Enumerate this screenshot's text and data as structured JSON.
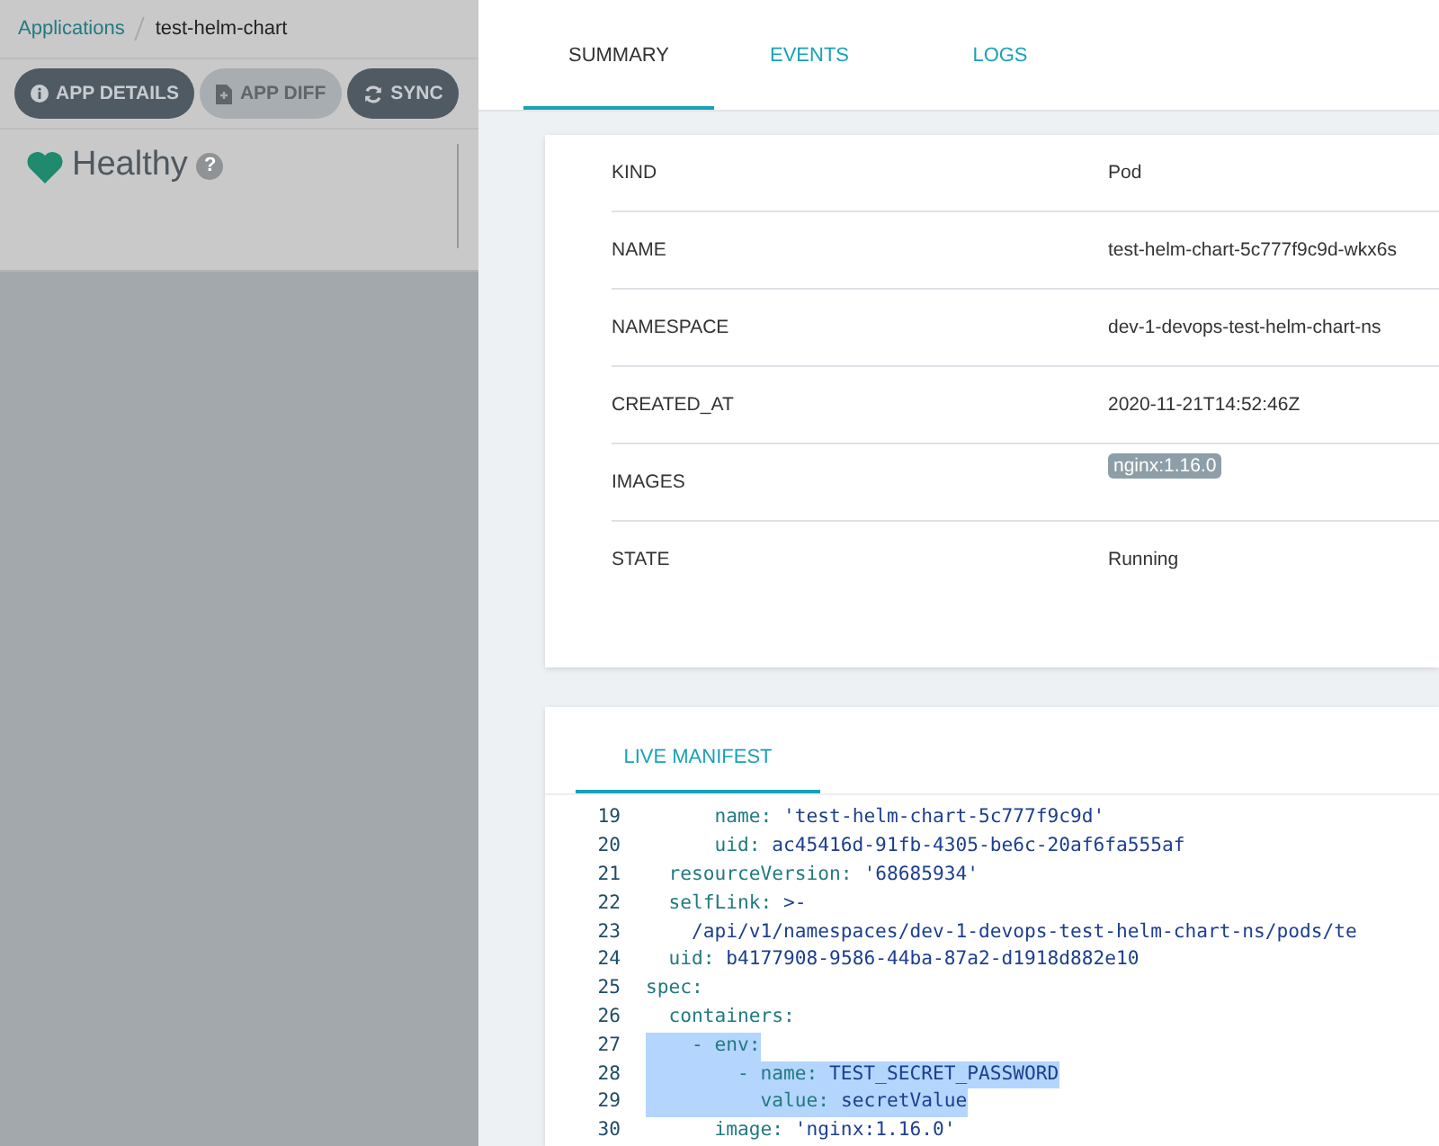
{
  "breadcrumb": {
    "link": "Applications",
    "current": "test-helm-chart"
  },
  "toolbar": [
    {
      "label": "APP DETAILS",
      "kind": "info",
      "disabled": false
    },
    {
      "label": "APP DIFF",
      "kind": "file",
      "disabled": true
    },
    {
      "label": "SYNC",
      "kind": "sync",
      "disabled": false
    }
  ],
  "health": {
    "status": "Healthy",
    "help": "?"
  },
  "tabs": [
    {
      "label": "SUMMARY",
      "selected": true
    },
    {
      "label": "EVENTS",
      "selected": false
    },
    {
      "label": "LOGS",
      "selected": false
    }
  ],
  "summary": [
    {
      "key": "KIND",
      "value": "Pod",
      "kind": "text"
    },
    {
      "key": "NAME",
      "value": "test-helm-chart-5c777f9c9d-wkx6s",
      "kind": "text"
    },
    {
      "key": "NAMESPACE",
      "value": "dev-1-devops-test-helm-chart-ns",
      "kind": "text"
    },
    {
      "key": "CREATED_AT",
      "value": "2020-11-21T14:52:46Z",
      "kind": "text"
    },
    {
      "key": "IMAGES",
      "value": "nginx:1.16.0",
      "kind": "tag"
    },
    {
      "key": "STATE",
      "value": "Running",
      "kind": "text"
    }
  ],
  "manifest_tab": {
    "label": "LIVE MANIFEST",
    "selected": true
  },
  "code": [
    {
      "n": "19",
      "key": "      name:",
      "value": " 'test-helm-chart-5c777f9c9d'",
      "selected": false
    },
    {
      "n": "20",
      "key": "      uid:",
      "value": " ac45416d-91fb-4305-be6c-20af6fa555af",
      "selected": false
    },
    {
      "n": "21",
      "key": "  resourceVersion:",
      "value": " '68685934'",
      "selected": false
    },
    {
      "n": "22",
      "key": "  selfLink:",
      "value": " >-",
      "selected": false
    },
    {
      "n": "23",
      "value": "    /api/v1/namespaces/dev-1-devops-test-helm-chart-ns/pods/te",
      "selected": false
    },
    {
      "n": "24",
      "key": "  uid:",
      "value": " b4177908-9586-44ba-87a2-d1918d882e10",
      "selected": false
    },
    {
      "n": "25",
      "key": "spec:",
      "selected": false
    },
    {
      "n": "26",
      "key": "  containers:",
      "selected": false
    },
    {
      "n": "27",
      "key": "    - env:",
      "selected": true
    },
    {
      "n": "28",
      "key": "        - name:",
      "value": " TEST_SECRET_PASSWORD",
      "selected": true
    },
    {
      "n": "29",
      "key": "          value:",
      "value": " secretValue",
      "selected": true
    },
    {
      "n": "30",
      "key": "      image:",
      "value": " 'nginx:1.16.0'",
      "selected": false
    }
  ]
}
